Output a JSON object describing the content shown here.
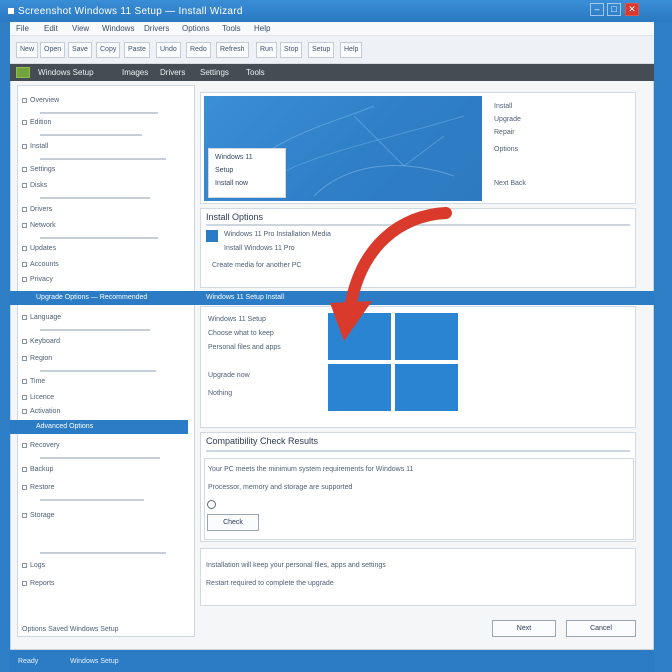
{
  "window": {
    "title": "Screenshot Windows 11 Setup — Install Wizard",
    "minimize_glyph": "–",
    "maximize_glyph": "□",
    "close_glyph": "✕"
  },
  "menubar": {
    "items": [
      "File",
      "Edit",
      "View",
      "Windows",
      "Drivers",
      "Options",
      "Tools",
      "Help"
    ]
  },
  "toolbar": {
    "buttons": [
      "New",
      "Open",
      "Save",
      "Copy",
      "Paste",
      "Undo",
      "Redo",
      "Refresh",
      "Run",
      "Stop",
      "Setup",
      "Help"
    ]
  },
  "darkbar": {
    "items": [
      "Windows Setup",
      "Images",
      "Drivers",
      "Settings",
      "Tools"
    ]
  },
  "sidebar": {
    "sections_top": [
      "Overview",
      "Edition",
      "Install",
      "Settings",
      "Disks",
      "Drivers",
      "Network",
      "Updates",
      "Accounts",
      "Privacy"
    ],
    "band1_label": "Upgrade Options — Recommended",
    "sections_mid": [
      "Language",
      "Keyboard",
      "Region",
      "Time",
      "Licence",
      "Activation"
    ],
    "band2_label": "Advanced Options",
    "sections_bottom": [
      "Recovery",
      "Backup",
      "Restore",
      "Storage",
      "Logs",
      "Reports"
    ],
    "footer": "Options  Saved  Windows  Setup"
  },
  "main": {
    "bluebar_label": "Windows 11 Setup Install",
    "hero_card_lines": [
      "Windows 11",
      "Setup",
      "Install now"
    ],
    "right_panel_lines": [
      "Install",
      "Upgrade",
      "Repair",
      "Options"
    ],
    "right_panel_footer": "Next  Back",
    "section1_title": "Install Options",
    "section1_lines": [
      "Windows 11 Pro Installation Media",
      "Install Windows 11 Pro",
      "Create media for another PC"
    ],
    "section2_lines": [
      "Windows 11 Setup",
      "Choose what to keep",
      "Personal files and apps",
      "Upgrade now",
      "Nothing"
    ],
    "section3_title": "Compatibility Check Results",
    "section3_lines": [
      "Your PC meets the minimum system requirements for Windows 11",
      "Processor, memory and storage are supported",
      "Check"
    ],
    "section4_lines": [
      "Installation will keep your personal files, apps and settings",
      "Restart required to complete the upgrade"
    ],
    "check_button": "Check",
    "next_button": "Next",
    "cancel_button": "Cancel"
  },
  "statusbar": {
    "left": "Ready",
    "right": "Windows Setup"
  },
  "colors": {
    "accent_blue": "#2b7cc5",
    "close_red": "#d9382c",
    "arrow_red": "#d93a2b",
    "dark_bar": "#454c54",
    "windows_logo": "#2b84d2"
  }
}
